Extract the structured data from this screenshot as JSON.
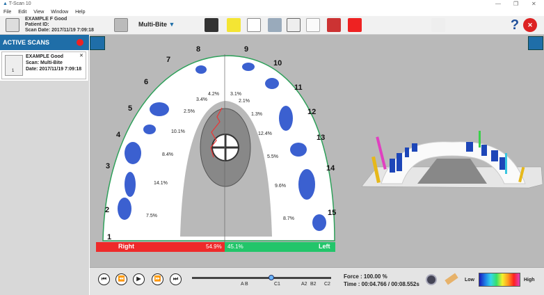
{
  "window": {
    "title": "T-Scan 10"
  },
  "menu": [
    "File",
    "Edit",
    "View",
    "Window",
    "Help"
  ],
  "patient": {
    "name": "EXAMPLE F Good",
    "id_label": "Patient ID:",
    "date_label": "Scan Date:",
    "date": "2017/11/19 7:09:18"
  },
  "toolbar": {
    "mode": "Multi-Bite"
  },
  "active_scans": {
    "title": "ACTIVE SCANS",
    "item": {
      "name": "EXAMPLE Good",
      "scan_label": "Scan:",
      "scan": "Multi-Bite",
      "date_label": "Date:",
      "date": "2017/11/19 7:09:18",
      "index": "1"
    }
  },
  "teeth": {
    "n1": "1",
    "n2": "2",
    "n3": "3",
    "n4": "4",
    "n5": "5",
    "n6": "6",
    "n7": "7",
    "n8": "8",
    "n9": "9",
    "n10": "10",
    "n11": "11",
    "n12": "12",
    "n13": "13",
    "n14": "14",
    "n15": "15"
  },
  "percents": {
    "p1": "4.2%",
    "p2": "3.4%",
    "p3": "2.5%",
    "p4": "10.1%",
    "p5": "8.4%",
    "p6": "14.1%",
    "p7": "7.5%",
    "p8": "3.1%",
    "p9": "2.1%",
    "p10": "1.3%",
    "p11": "12.4%",
    "p12": "5.5%",
    "p13": "9.6%",
    "p14": "8.7%"
  },
  "balance": {
    "right_label": "Right",
    "right_value": "54.9%",
    "left_value": "45.1%",
    "left_label": "Left",
    "right_color": "#ee2a2a",
    "left_color": "#22c56a"
  },
  "timeline": {
    "markers": [
      "A",
      "B",
      "C1",
      "A2",
      "B2",
      "C2"
    ]
  },
  "status": {
    "force": "Force : 100.00 %",
    "time": "Time : 00:04.766 / 00:08.552s"
  },
  "legend": {
    "low": "Low",
    "high": "High"
  }
}
